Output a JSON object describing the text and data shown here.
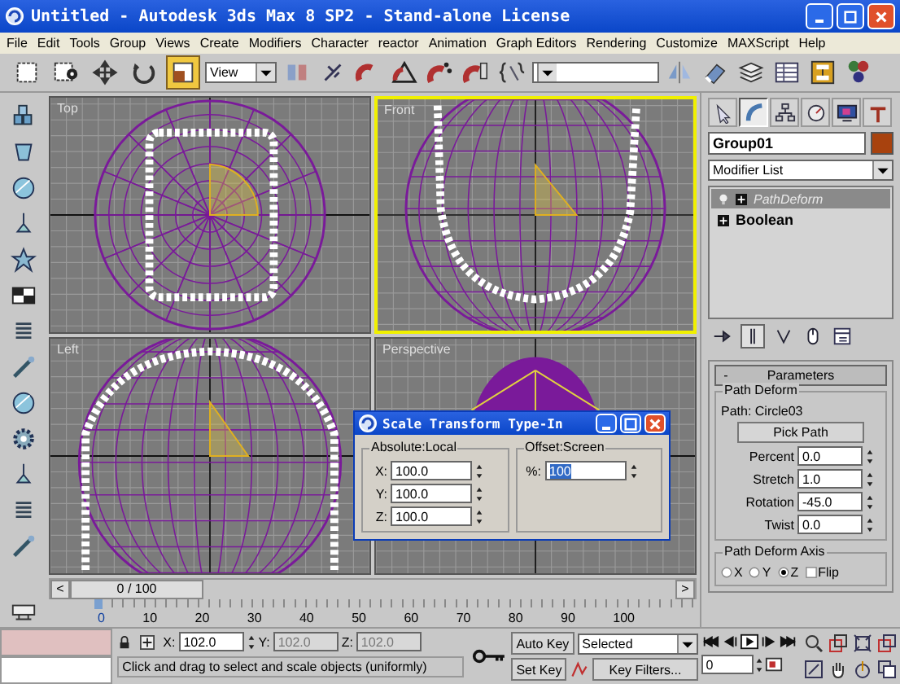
{
  "window": {
    "title": "Untitled - Autodesk 3ds Max 8 SP2 - Stand-alone License"
  },
  "menu": [
    "File",
    "Edit",
    "Tools",
    "Group",
    "Views",
    "Create",
    "Modifiers",
    "Character",
    "reactor",
    "Animation",
    "Graph Editors",
    "Rendering",
    "Customize",
    "MAXScript",
    "Help"
  ],
  "toolbar": {
    "tools": [
      {
        "kind": "select",
        "selected": false
      },
      {
        "kind": "select-name",
        "selected": false
      },
      {
        "kind": "move",
        "selected": false
      },
      {
        "kind": "rotate",
        "selected": false
      },
      {
        "kind": "scale",
        "selected": true
      }
    ],
    "coordinate_system": "View"
  },
  "viewports": [
    {
      "label": "Top",
      "kind": "top",
      "selected": false
    },
    {
      "label": "Front",
      "kind": "front",
      "selected": true
    },
    {
      "label": "Left",
      "kind": "left",
      "selected": false
    },
    {
      "label": "Perspective",
      "kind": "perspective",
      "selected": false
    }
  ],
  "time_slider": {
    "prev": "<",
    "position": "0 / 100",
    "next": ">",
    "level": 0
  },
  "timeline": {
    "ticks": [
      "0",
      "10",
      "20",
      "30",
      "40",
      "50",
      "60",
      "70",
      "80",
      "90",
      "100"
    ]
  },
  "command_panel": {
    "tabs": [
      {
        "kind": "create",
        "selected": false
      },
      {
        "kind": "modify",
        "selected": true
      },
      {
        "kind": "hierarchy",
        "selected": false
      },
      {
        "kind": "motion",
        "selected": false
      },
      {
        "kind": "display",
        "selected": false
      },
      {
        "kind": "utilities",
        "selected": false
      }
    ],
    "object_name": "Group01",
    "modifier_list": "Modifier List",
    "stack": [
      {
        "name": "PathDeform",
        "kind": "modifier",
        "selected": true
      },
      {
        "name": "Boolean",
        "kind": "object",
        "selected": false
      }
    ]
  },
  "parameters": {
    "toggle": "-",
    "title": "Parameters",
    "group": "Path Deform",
    "path": "Path: Circle03",
    "pick_button": "Pick Path",
    "spinners": [
      {
        "label": "Percent",
        "value": "0.0"
      },
      {
        "label": "Stretch",
        "value": "1.0"
      },
      {
        "label": "Rotation",
        "value": "-45.0"
      },
      {
        "label": "Twist",
        "value": "0.0"
      }
    ],
    "axis_group": "Path Deform Axis",
    "axes": [
      {
        "label": "X",
        "selected": false
      },
      {
        "label": "Y",
        "selected": false
      },
      {
        "label": "Z",
        "selected": true
      }
    ],
    "flip": {
      "label": "Flip",
      "checked": false
    }
  },
  "dialog": {
    "title": "Scale Transform Type-In",
    "absolute_group": "Absolute:Local",
    "absolute": [
      {
        "label": "X:",
        "value": "100.0"
      },
      {
        "label": "Y:",
        "value": "100.0"
      },
      {
        "label": "Z:",
        "value": "100.0"
      }
    ],
    "offset_group": "Offset:Screen",
    "offset": {
      "label": "%:",
      "value": "100",
      "selected": true
    }
  },
  "status": {
    "coords": [
      {
        "label": "X:",
        "value": "102.0",
        "disabled": false
      },
      {
        "label": "Y:",
        "value": "102.0",
        "disabled": true
      },
      {
        "label": "Z:",
        "value": "102.0",
        "disabled": true
      }
    ],
    "prompt": "Click and drag to select and scale objects (uniformly)"
  },
  "keys": {
    "auto_key": "Auto Key",
    "key_mode": "Selected",
    "set_key": "Set Key",
    "key_filters": "Key Filters..."
  },
  "playback": {
    "frame": "0"
  }
}
